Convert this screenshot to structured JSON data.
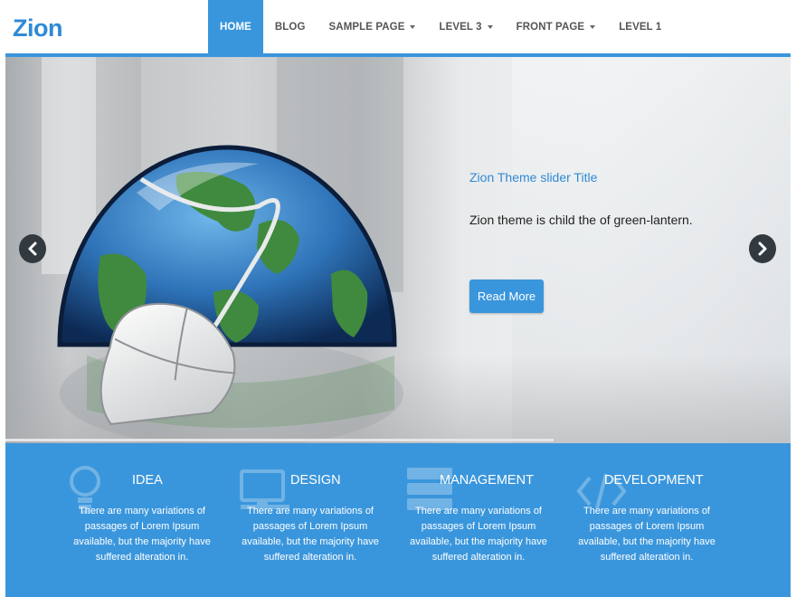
{
  "site": {
    "logo": "Zion"
  },
  "nav": {
    "items": [
      {
        "label": "HOME",
        "active": true,
        "dropdown": false
      },
      {
        "label": "BLOG",
        "active": false,
        "dropdown": false
      },
      {
        "label": "SAMPLE PAGE",
        "active": false,
        "dropdown": true
      },
      {
        "label": "LEVEL 3",
        "active": false,
        "dropdown": true
      },
      {
        "label": "FRONT PAGE",
        "active": false,
        "dropdown": true
      },
      {
        "label": "LEVEL 1",
        "active": false,
        "dropdown": false
      }
    ]
  },
  "slider": {
    "title": "Zion Theme slider Title",
    "text": "Zion theme is child the of green-lantern.",
    "button": "Read More",
    "prev_icon": "chevron-left-icon",
    "next_icon": "chevron-right-icon"
  },
  "services": [
    {
      "title": "IDEA",
      "icon": "lightbulb-icon",
      "text": "There are many variations of passages of Lorem Ipsum available, but the majority have suffered alteration in."
    },
    {
      "title": "DESIGN",
      "icon": "monitor-icon",
      "text": "There are many variations of passages of Lorem Ipsum available, but the majority have suffered alteration in."
    },
    {
      "title": "MANAGEMENT",
      "icon": "server-icon",
      "text": "There are many variations of passages of Lorem Ipsum available, but the majority have suffered alteration in."
    },
    {
      "title": "DEVELOPMENT",
      "icon": "code-icon",
      "text": "There are many variations of passages of Lorem Ipsum available, but the majority have suffered alteration in."
    }
  ],
  "colors": {
    "accent": "#3a96dc",
    "logo": "#2f8ad6",
    "nav_text": "#555555",
    "arrow_bg": "#333a3f"
  }
}
